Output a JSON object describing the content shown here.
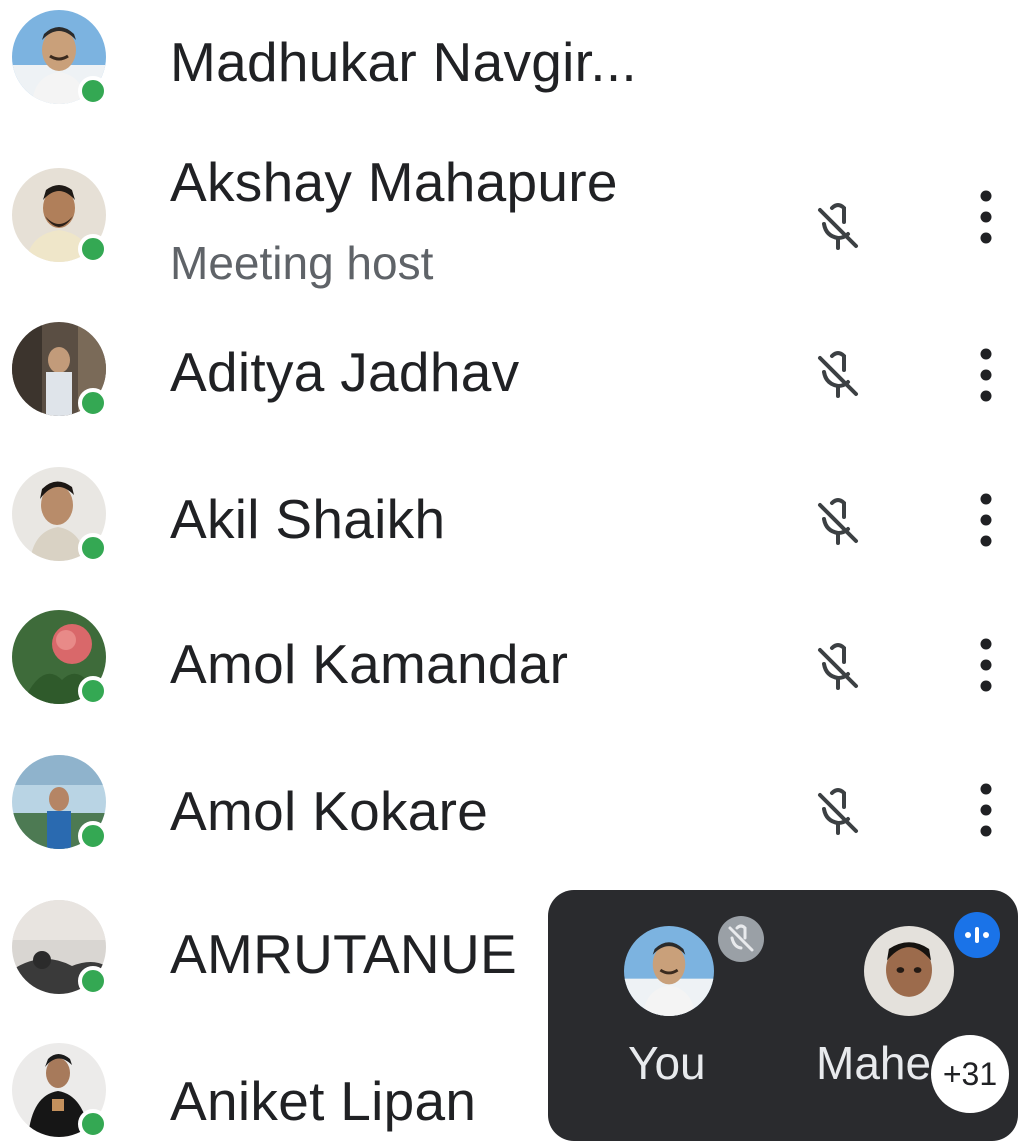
{
  "participants": [
    {
      "name": "Madhukar Navgir...",
      "subtitle": "",
      "online": true,
      "mic": "none"
    },
    {
      "name": "Akshay Mahapure",
      "subtitle": "Meeting host",
      "online": true,
      "mic": "muted"
    },
    {
      "name": "Aditya Jadhav",
      "subtitle": "",
      "online": true,
      "mic": "muted"
    },
    {
      "name": "Akil Shaikh",
      "subtitle": "",
      "online": true,
      "mic": "muted"
    },
    {
      "name": "Amol Kamandar",
      "subtitle": "",
      "online": true,
      "mic": "muted"
    },
    {
      "name": "Amol Kokare",
      "subtitle": "",
      "online": true,
      "mic": "muted"
    },
    {
      "name": "AMRUTANUE",
      "subtitle": "",
      "online": true,
      "mic": "none"
    },
    {
      "name": "Aniket Lipan",
      "subtitle": "",
      "online": true,
      "mic": "none"
    }
  ],
  "overlay": {
    "tiles": [
      {
        "label": "You",
        "badge": "mic-off-icon"
      },
      {
        "label": "Mahe",
        "badge": "speaking-icon"
      }
    ],
    "extra_count": "+31"
  },
  "colors": {
    "online": "#34a853",
    "overlay_bg": "#2a2b2e",
    "speaking": "#1a73e8",
    "secondary_text": "#5f6368"
  }
}
